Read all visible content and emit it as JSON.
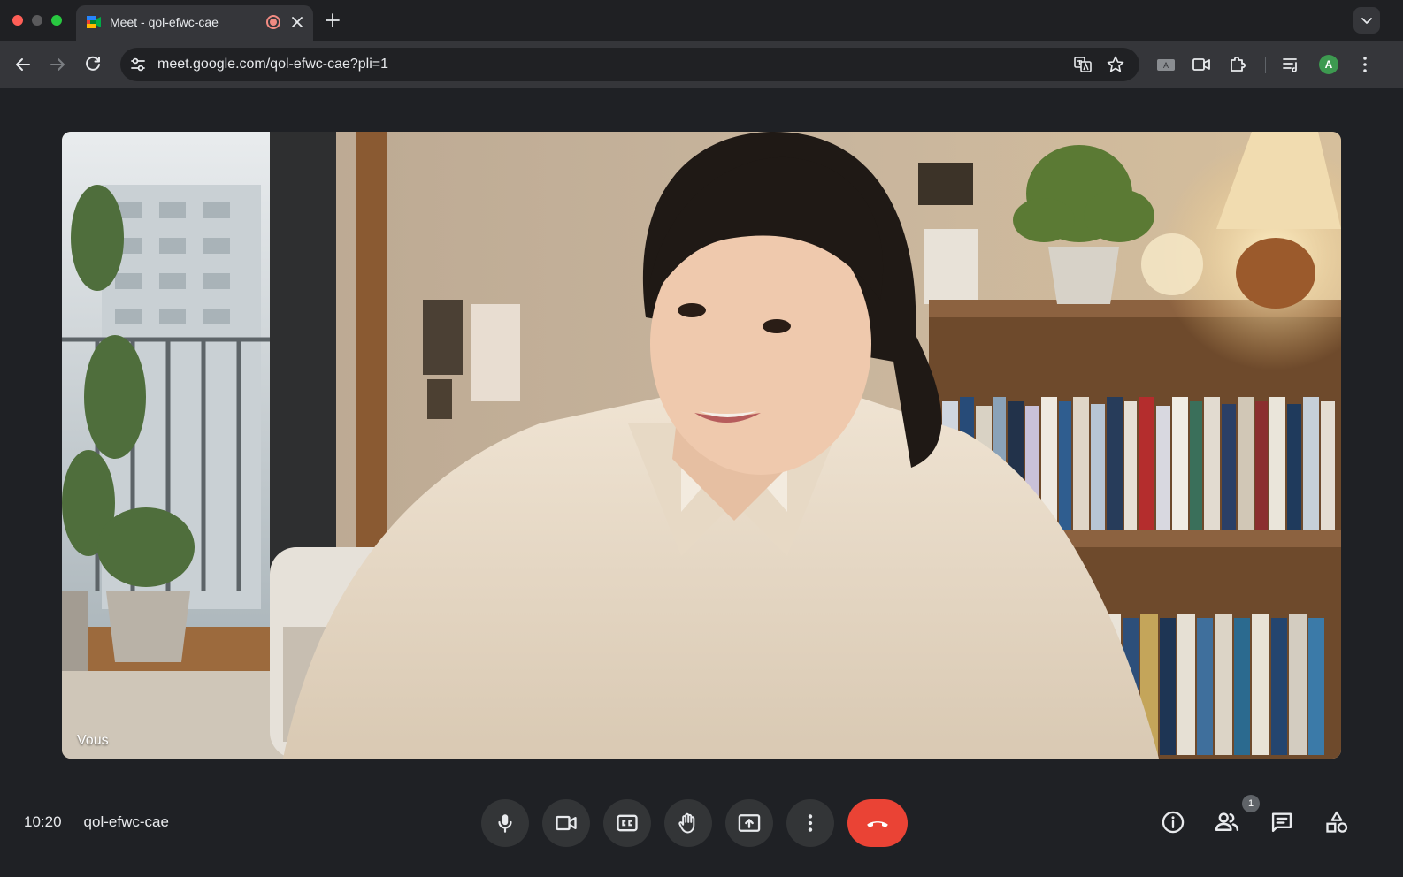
{
  "browser": {
    "tab": {
      "title": "Meet - qol-efwc-cae",
      "favicon": "google-meet-icon",
      "recording_indicator": "recording-icon"
    },
    "address_bar": {
      "url": "meet.google.com/qol-efwc-cae?pli=1"
    },
    "profile_initial": "A",
    "colors": {
      "tabstrip": "#1f2023",
      "toolbar": "#35363a",
      "omnibox": "#202124"
    }
  },
  "meet": {
    "self_view_label": "Vous",
    "time": "10:20",
    "meeting_code": "qol-efwc-cae",
    "controls": [
      {
        "name": "microphone",
        "icon": "mic-icon"
      },
      {
        "name": "camera",
        "icon": "videocam-icon"
      },
      {
        "name": "captions",
        "icon": "closed-caption-icon"
      },
      {
        "name": "raise-hand",
        "icon": "hand-icon"
      },
      {
        "name": "present",
        "icon": "present-screen-icon"
      },
      {
        "name": "more-options",
        "icon": "more-vert-icon"
      },
      {
        "name": "leave-call",
        "icon": "call-end-icon"
      }
    ],
    "side_panels": [
      {
        "name": "meeting-details",
        "icon": "info-icon"
      },
      {
        "name": "people",
        "icon": "people-icon",
        "badge": "1"
      },
      {
        "name": "chat",
        "icon": "chat-icon"
      },
      {
        "name": "activities",
        "icon": "activities-icon"
      }
    ],
    "colors": {
      "end_call": "#ea4335",
      "control": "#333537",
      "background": "#1f2125"
    }
  }
}
